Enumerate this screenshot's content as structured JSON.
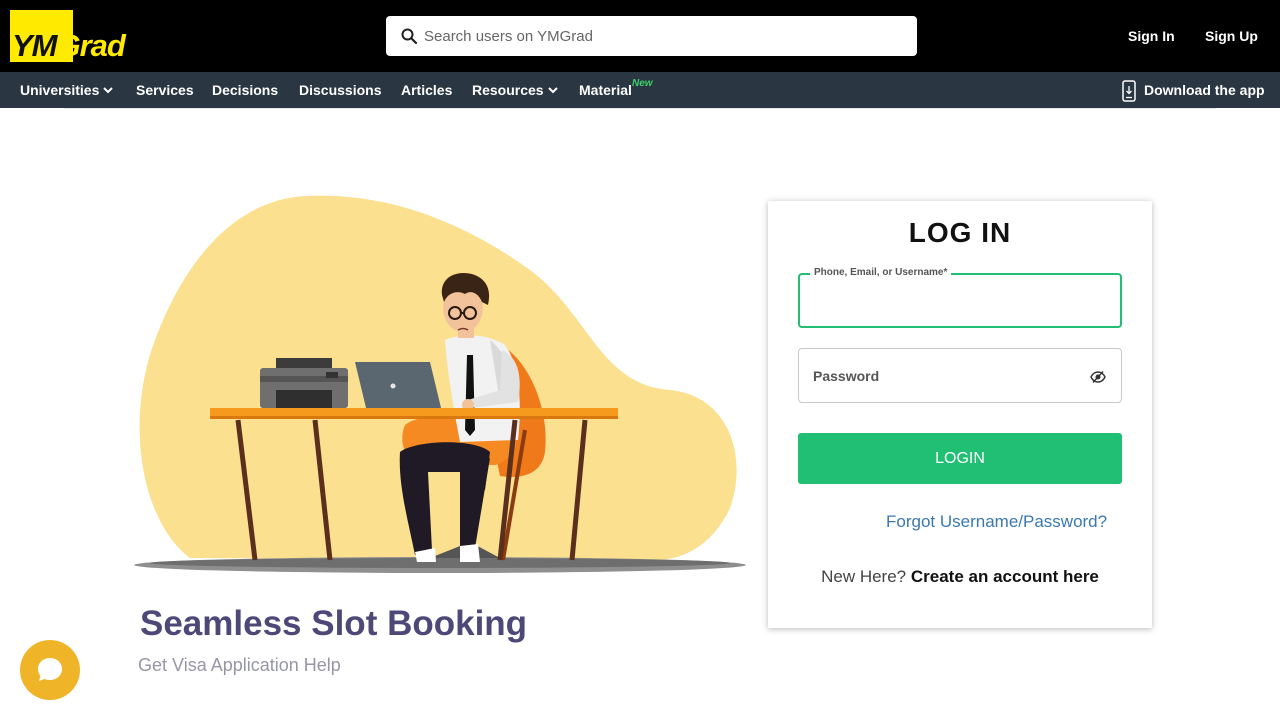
{
  "header": {
    "logo": {
      "part1": "YM",
      "part2": "Grad"
    },
    "search": {
      "placeholder": "Search users on YMGrad"
    },
    "sign_in": "Sign In",
    "sign_up": "Sign Up"
  },
  "nav": {
    "items": [
      {
        "label": "Universities",
        "has_dropdown": true
      },
      {
        "label": "Services",
        "has_dropdown": false
      },
      {
        "label": "Decisions",
        "has_dropdown": false
      },
      {
        "label": "Discussions",
        "has_dropdown": false
      },
      {
        "label": "Articles",
        "has_dropdown": false
      },
      {
        "label": "Resources",
        "has_dropdown": true
      },
      {
        "label": "Material",
        "has_dropdown": false,
        "badge": "New"
      }
    ],
    "download": "Download the app"
  },
  "promo": {
    "title": "Seamless Slot Booking",
    "subtitle": "Get Visa Application Help"
  },
  "login": {
    "title": "LOG IN",
    "username_label": "Phone, Email, or Username*",
    "username_value": "",
    "password_label": "Password",
    "password_value": "",
    "button": "LOGIN",
    "forgot": "Forgot Username/Password?",
    "new_here": "New Here?",
    "create": "Create an account here"
  },
  "icons": {
    "search": "search-icon",
    "chevron": "chevron-down-icon",
    "phone": "phone-icon",
    "eye": "eye-slash-icon",
    "chat": "chat-icon"
  },
  "colors": {
    "brand_yellow": "#ffea00",
    "top_bar": "#000000",
    "nav_bar": "#2a3641",
    "accent_green": "#20bf73",
    "link_blue": "#3b78b0",
    "promo_title": "#4d4878",
    "chat_bubble": "#f0b429",
    "blob": "#fbe08f"
  }
}
